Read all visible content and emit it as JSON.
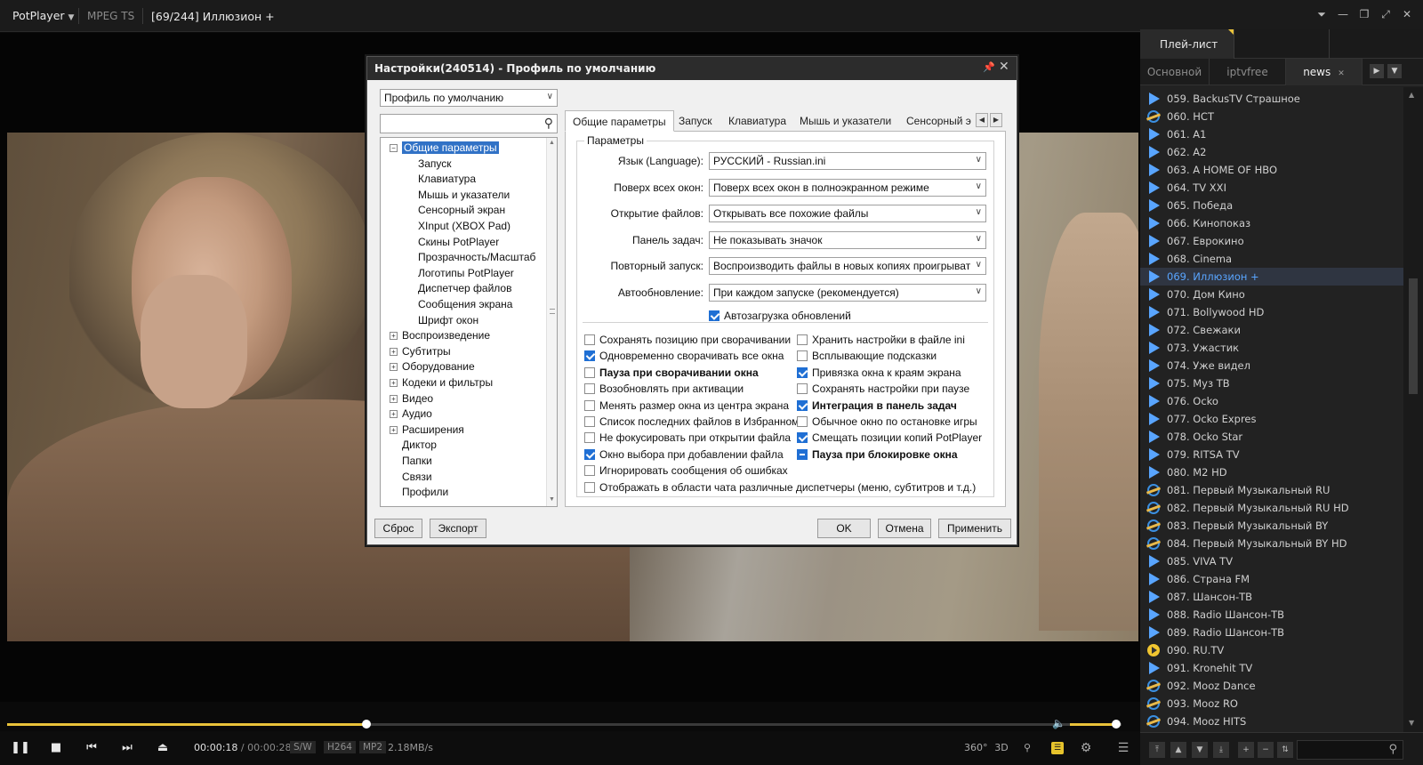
{
  "titlebar": {
    "app_name": "PotPlayer",
    "format": "MPEG TS",
    "now_playing": "[69/244] Иллюзион +"
  },
  "player": {
    "seek_progress": 0.325,
    "volume_level": 0.9,
    "time_current": "00:00:18",
    "time_separator": "/",
    "time_total": "00:00:28",
    "tag_sw": "S/W",
    "tag_codec": "H264",
    "tag_audio": "MP2",
    "bitrate": "2.18MB/s",
    "btn_360": "360°",
    "btn_3d": "3D"
  },
  "playlist": {
    "header": "Плей-лист",
    "tabs": [
      "Основной",
      "iptvfree",
      "news"
    ],
    "active_tab": 2,
    "items": [
      {
        "n": "059. BackusTV Страшное",
        "icon": "play"
      },
      {
        "n": "060. НСТ",
        "icon": "ie"
      },
      {
        "n": "061. A1",
        "icon": "play"
      },
      {
        "n": "062. A2",
        "icon": "play"
      },
      {
        "n": "063. A HOME OF HBO",
        "icon": "play"
      },
      {
        "n": "064. TV XXI",
        "icon": "play"
      },
      {
        "n": "065. Победа",
        "icon": "play"
      },
      {
        "n": "066. Кинопоказ",
        "icon": "play"
      },
      {
        "n": "067. Еврокино",
        "icon": "play"
      },
      {
        "n": "068. Cinema",
        "icon": "play"
      },
      {
        "n": "069. Иллюзион +",
        "icon": "play",
        "current": true
      },
      {
        "n": "070. Дом Кино",
        "icon": "play"
      },
      {
        "n": "071. Bollywood HD",
        "icon": "play"
      },
      {
        "n": "072. Свежаки",
        "icon": "play"
      },
      {
        "n": "073. Ужастик",
        "icon": "play"
      },
      {
        "n": "074. Уже видел",
        "icon": "play"
      },
      {
        "n": "075. Муз ТВ",
        "icon": "play"
      },
      {
        "n": "076. Ocko",
        "icon": "play"
      },
      {
        "n": "077. Ocko Expres",
        "icon": "play"
      },
      {
        "n": "078. Ocko Star",
        "icon": "play"
      },
      {
        "n": "079. RITSA TV",
        "icon": "play"
      },
      {
        "n": "080. M2 HD",
        "icon": "play"
      },
      {
        "n": "081. Первый Музыкальный RU",
        "icon": "ie"
      },
      {
        "n": "082. Первый Музыкальный RU HD",
        "icon": "ie"
      },
      {
        "n": "083. Первый Музыкальный BY",
        "icon": "ie"
      },
      {
        "n": "084. Первый Музыкальный BY HD",
        "icon": "ie"
      },
      {
        "n": "085. VIVA TV",
        "icon": "play"
      },
      {
        "n": "086. Страна FM",
        "icon": "play"
      },
      {
        "n": "087. Шансон-ТВ",
        "icon": "play"
      },
      {
        "n": "088. Radio Шансон-ТВ",
        "icon": "play"
      },
      {
        "n": "089. Radio Шансон-ТВ",
        "icon": "play"
      },
      {
        "n": "090. RU.TV",
        "icon": "yellow"
      },
      {
        "n": "091. Kronehit TV",
        "icon": "play"
      },
      {
        "n": "092. Mooz Dance",
        "icon": "ie"
      },
      {
        "n": "093. Mooz RO",
        "icon": "ie"
      },
      {
        "n": "094. Mooz HITS",
        "icon": "ie"
      }
    ]
  },
  "dialog": {
    "title": "Настройки(240514) - Профиль по умолчанию",
    "profile_select": "Профиль по умолчанию",
    "tree": [
      "Общие параметры",
      "Запуск",
      "Клавиатура",
      "Мышь и указатели",
      "Сенсорный экран",
      "XInput (XBOX Pad)",
      "Скины PotPlayer",
      "Прозрачность/Масштаб",
      "Логотипы PotPlayer",
      "Диспетчер файлов",
      "Сообщения экрана",
      "Шрифт окон",
      "Воспроизведение",
      "Субтитры",
      "Оборудование",
      "Кодеки и фильтры",
      "Видео",
      "Аудио",
      "Расширения",
      "Диктор",
      "Папки",
      "Связи",
      "Профили"
    ],
    "tabs": [
      "Общие параметры",
      "Запуск",
      "Клавиатура",
      "Мышь и указатели",
      "Сенсорный э"
    ],
    "group_label": "Параметры",
    "fields": [
      {
        "label": "Язык (Language):",
        "value": "РУССКИЙ - Russian.ini"
      },
      {
        "label": "Поверх всех окон:",
        "value": "Поверх всех окон в полноэкранном режиме"
      },
      {
        "label": "Открытие файлов:",
        "value": "Открывать все похожие файлы"
      },
      {
        "label": "Панель задач:",
        "value": "Не показывать значок"
      },
      {
        "label": "Повторный запуск:",
        "value": "Воспроизводить файлы в новых копиях проигрыват"
      },
      {
        "label": "Автообновление:",
        "value": "При каждом запуске (рекомендуется)"
      }
    ],
    "autoupdate_check": "Автозагрузка обновлений",
    "checks_left": [
      {
        "l": "Сохранять позицию при сворачивании",
        "s": "off"
      },
      {
        "l": "Одновременно сворачивать все окна",
        "s": "on"
      },
      {
        "l": "Пауза при сворачивании окна",
        "s": "off",
        "bold": true
      },
      {
        "l": "Возобновлять при активации",
        "s": "off"
      },
      {
        "l": "Менять размер окна из центра экрана",
        "s": "off"
      },
      {
        "l": "Список последних файлов в Избранном",
        "s": "off"
      },
      {
        "l": "Не фокусировать при открытии файла",
        "s": "off"
      },
      {
        "l": "Окно выбора при добавлении файла",
        "s": "on"
      },
      {
        "l": "Игнорировать сообщения об ошибках",
        "s": "off"
      }
    ],
    "checks_right": [
      {
        "l": "Хранить настройки в файле ini",
        "s": "off"
      },
      {
        "l": "Всплывающие подсказки",
        "s": "off"
      },
      {
        "l": "Привязка окна к краям экрана",
        "s": "on"
      },
      {
        "l": "Сохранять настройки при паузе",
        "s": "off"
      },
      {
        "l": "Интеграция в панель задач",
        "s": "on",
        "bold": true
      },
      {
        "l": "Обычное окно по остановке игры",
        "s": "off"
      },
      {
        "l": "Смещать позиции копий PotPlayer",
        "s": "on"
      },
      {
        "l": "Пауза при блокировке окна",
        "s": "mid",
        "bold": true
      }
    ],
    "check_wide": "Отображать в области чата различные диспетчеры (меню, субтитров и т.д.)",
    "buttons": {
      "reset": "Сброс",
      "export": "Экспорт",
      "ok": "OK",
      "cancel": "Отмена",
      "apply": "Применить"
    }
  },
  "colors": {
    "accent": "#e9c23a",
    "playlist_current": "#59a5ff",
    "selection": "#3172c6",
    "checkbox": "#1f6fd4"
  }
}
